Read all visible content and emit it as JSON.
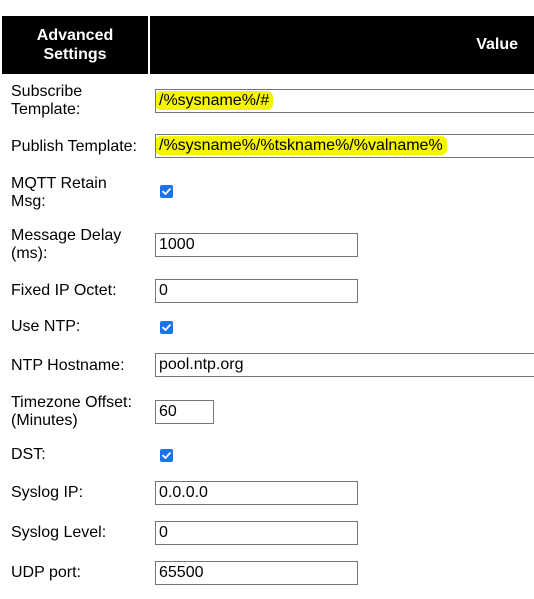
{
  "header": {
    "settings_label": "Advanced\nSettings",
    "settings_line1": "Advanced",
    "settings_line2": "Settings",
    "value_label": "Value"
  },
  "rows": [
    {
      "label_line1": "Subscribe",
      "label_line2": "Template:",
      "value": "/%sysname%/#",
      "type": "text",
      "highlighted": true
    },
    {
      "label": "Publish Template:",
      "value": "/%sysname%/%tskname%/%valname%",
      "type": "text",
      "highlighted": true
    },
    {
      "label_line1": "MQTT Retain",
      "label_line2": "Msg:",
      "checked": true,
      "type": "checkbox"
    },
    {
      "label_line1": "Message Delay",
      "label_line2": "(ms):",
      "value": "1000",
      "type": "text"
    },
    {
      "label": "Fixed IP Octet:",
      "value": "0",
      "type": "text"
    },
    {
      "label": "Use NTP:",
      "checked": true,
      "type": "checkbox"
    },
    {
      "label": "NTP Hostname:",
      "value": "pool.ntp.org",
      "type": "text"
    },
    {
      "label_line1": "Timezone Offset:",
      "label_line2": "(Minutes)",
      "value": "60",
      "type": "text"
    },
    {
      "label": "DST:",
      "checked": true,
      "type": "checkbox"
    },
    {
      "label": "Syslog IP:",
      "value": "0.0.0.0",
      "type": "text"
    },
    {
      "label": "Syslog Level:",
      "value": "0",
      "type": "text"
    },
    {
      "label": "UDP port:",
      "value": "65500",
      "type": "text"
    }
  ],
  "colors": {
    "header_bg": "#000000",
    "header_text": "#ffffff",
    "highlight": "#f5f500",
    "checkbox": "#1a73e8"
  }
}
